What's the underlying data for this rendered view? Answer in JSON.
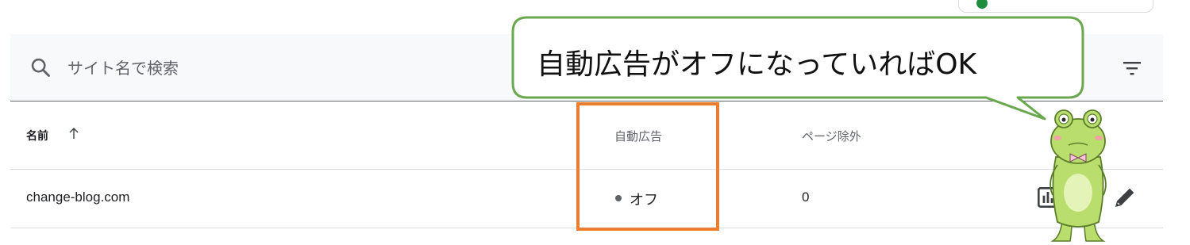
{
  "search": {
    "placeholder": "サイト名で検索"
  },
  "table": {
    "columns": {
      "name": "名前",
      "auto_ads": "自動広告",
      "page_exclusions": "ページ除外"
    },
    "rows": [
      {
        "name": "change-blog.com",
        "auto_ads": "オフ",
        "page_exclusions": "0"
      }
    ]
  },
  "annotation": {
    "callout": "自動広告がオフになっていればOK"
  },
  "icons": {
    "search": "search-icon",
    "filter": "filter-icon",
    "sort": "arrow-up-icon",
    "report": "bar-chart-icon",
    "edit": "pencil-icon"
  },
  "colors": {
    "highlight_border": "#ea7d2e",
    "callout_border": "#6aa84f",
    "status_dot": "#5f6368",
    "top_button_dot": "#1e8e3e"
  }
}
